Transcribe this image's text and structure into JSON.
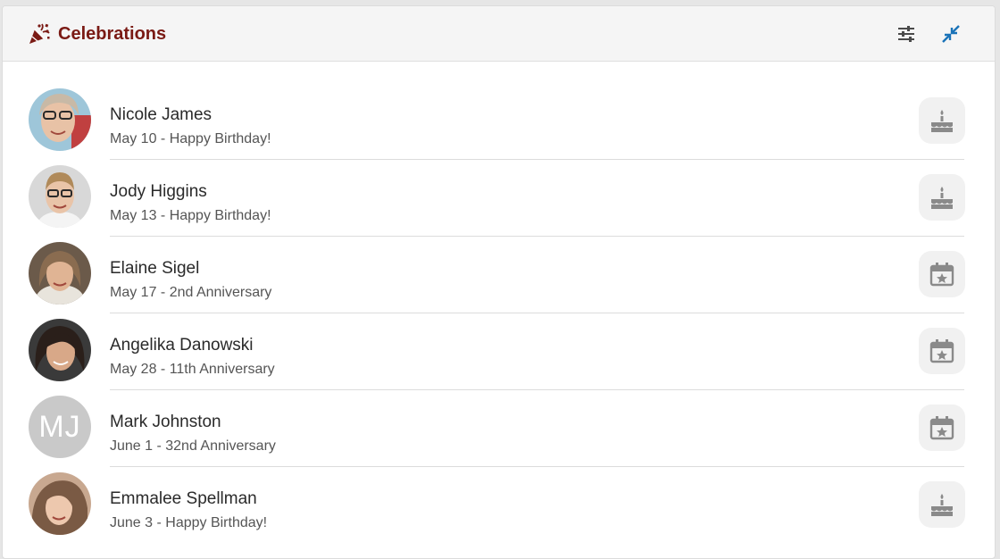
{
  "header": {
    "title": "Celebrations",
    "title_icon": "party-popper-icon",
    "filter_icon": "sliders-icon",
    "collapse_icon": "collapse-arrows-icon",
    "title_color": "#7a1a14",
    "collapse_color": "#1a73b8"
  },
  "celebrations": [
    {
      "name": "Nicole James",
      "detail": "May 10 - Happy Birthday!",
      "type": "birthday",
      "icon": "birthday-cake-icon"
    },
    {
      "name": "Jody Higgins",
      "detail": "May 13 - Happy Birthday!",
      "type": "birthday",
      "icon": "birthday-cake-icon"
    },
    {
      "name": "Elaine Sigel",
      "detail": "May 17 - 2nd Anniversary",
      "type": "anniversary",
      "icon": "calendar-star-icon"
    },
    {
      "name": "Angelika Danowski",
      "detail": "May 28 - 11th Anniversary",
      "type": "anniversary",
      "icon": "calendar-star-icon"
    },
    {
      "name": "Mark Johnston",
      "detail": "June 1 - 32nd Anniversary",
      "type": "anniversary",
      "icon": "calendar-star-icon",
      "initials": "MJ"
    },
    {
      "name": "Emmalee Spellman",
      "detail": "June 3 - Happy Birthday!",
      "type": "birthday",
      "icon": "birthday-cake-icon"
    }
  ]
}
